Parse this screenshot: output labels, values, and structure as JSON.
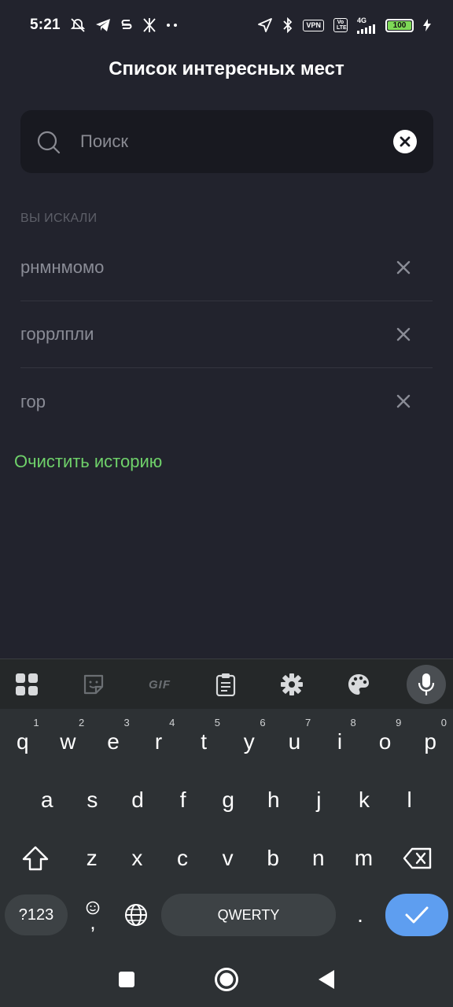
{
  "status_bar": {
    "time": "5:21",
    "vpn_label": "VPN",
    "volte_label": "Vo LTE",
    "network_label": "4G",
    "battery_level": "100",
    "battery_color": "#7ed957"
  },
  "header": {
    "title": "Список интересных мест"
  },
  "search": {
    "placeholder": "Поиск",
    "value": "",
    "icon": "search-icon",
    "clear_icon": "clear-icon"
  },
  "history": {
    "header": "ВЫ ИСКАЛИ",
    "items": [
      {
        "text": "рнмнмомо"
      },
      {
        "text": "горрлпли"
      },
      {
        "text": "гор"
      }
    ],
    "clear_label": "Очистить историю",
    "accent_color": "#6fd16a"
  },
  "keyboard": {
    "toolbar": {
      "items": [
        "apps-grid-icon",
        "sticker-icon",
        "GIF",
        "clipboard-icon",
        "settings-icon",
        "palette-icon",
        "mic-icon"
      ],
      "gif_label": "GIF"
    },
    "row1": [
      {
        "key": "q",
        "hint": "1"
      },
      {
        "key": "w",
        "hint": "2"
      },
      {
        "key": "e",
        "hint": "3"
      },
      {
        "key": "r",
        "hint": "4"
      },
      {
        "key": "t",
        "hint": "5"
      },
      {
        "key": "y",
        "hint": "6"
      },
      {
        "key": "u",
        "hint": "7"
      },
      {
        "key": "i",
        "hint": "8"
      },
      {
        "key": "o",
        "hint": "9"
      },
      {
        "key": "p",
        "hint": "0"
      }
    ],
    "row2": [
      "a",
      "s",
      "d",
      "f",
      "g",
      "h",
      "j",
      "k",
      "l"
    ],
    "row3": [
      "z",
      "x",
      "c",
      "v",
      "b",
      "n",
      "m"
    ],
    "symbols_label": "?123",
    "space_label": "QWERTY",
    "period_label": ".",
    "comma_label": ",",
    "enter_color": "#5e9ef0"
  }
}
